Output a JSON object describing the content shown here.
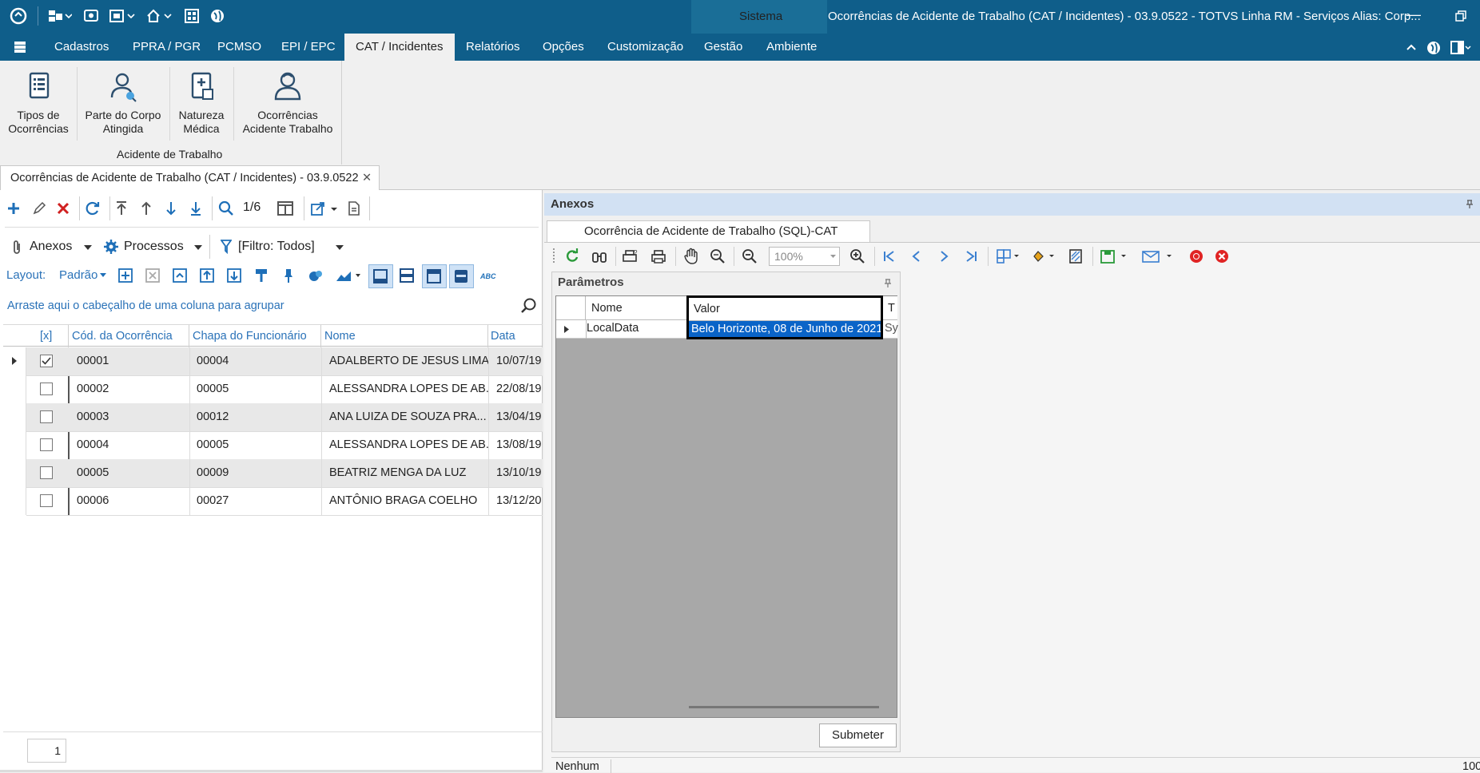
{
  "titlebar": {
    "sistema": "Sistema",
    "title": "Ocorrências de Acidente de Trabalho (CAT / Incidentes) - 03.9.0522 - TOTVS Linha RM - Serviços  Alias: Corp..."
  },
  "menu": [
    "Cadastros",
    "PPRA / PGR",
    "PCMSO",
    "EPI / EPC",
    "CAT / Incidentes",
    "Relatórios",
    "Opções",
    "Customização",
    "Gestão",
    "Ambiente"
  ],
  "ribbon": {
    "buttons": [
      {
        "label1": "Tipos de",
        "label2": "Ocorrências",
        "icon": "document-list-icon"
      },
      {
        "label1": "Parte do Corpo",
        "label2": "Atingida",
        "icon": "person-search-icon"
      },
      {
        "label1": "Natureza",
        "label2": "Médica",
        "icon": "medical-book-icon"
      },
      {
        "label1": "Ocorrências",
        "label2": "Acidente Trabalho",
        "icon": "person-icon"
      }
    ],
    "group": "Acidente de Trabalho"
  },
  "doc_tab": "Ocorrências de Acidente de Trabalho (CAT / Incidentes) - 03.9.0522",
  "left": {
    "record_counter": "1/6",
    "anexos": "Anexos",
    "processos": "Processos",
    "filtro": "[Filtro: Todos]",
    "layout_label": "Layout:",
    "layout_value": "Padrão",
    "group_hint": "Arraste aqui o cabeçalho de uma coluna para agrupar",
    "columns": [
      "[x]",
      "Cód. da Ocorrência",
      "Chapa do Funcionário",
      "Nome",
      "Data"
    ],
    "rows": [
      {
        "checked": true,
        "cod": "00001",
        "chapa": "00004",
        "nome": "ADALBERTO DE JESUS LIMA",
        "data": "10/07/19"
      },
      {
        "checked": false,
        "cod": "00002",
        "chapa": "00005",
        "nome": "ALESSANDRA LOPES DE AB...",
        "data": "22/08/19"
      },
      {
        "checked": false,
        "cod": "00003",
        "chapa": "00012",
        "nome": "ANA LUIZA  DE SOUZA PRA...",
        "data": "13/04/19"
      },
      {
        "checked": false,
        "cod": "00004",
        "chapa": "00005",
        "nome": "ALESSANDRA LOPES DE AB...",
        "data": "13/08/19"
      },
      {
        "checked": false,
        "cod": "00005",
        "chapa": "00009",
        "nome": "BEATRIZ MENGA DA LUZ",
        "data": "13/10/19"
      },
      {
        "checked": false,
        "cod": "00006",
        "chapa": "00027",
        "nome": "ANTÔNIO BRAGA COELHO",
        "data": "13/12/20"
      }
    ],
    "page": "1"
  },
  "right": {
    "header": "Anexos",
    "report_tab": "Ocorrência de Acidente de Trabalho (SQL)-CAT",
    "zoom": "100%",
    "params_title": "Parâmetros",
    "param_columns": [
      "Nome",
      "Valor",
      "T"
    ],
    "param_row": {
      "nome": "LocalData",
      "valor": "Belo Horizonte, 08 de Junho de 2021.",
      "tipo": "Sy"
    },
    "submit": "Submeter",
    "status_left": "Nenhum",
    "status_right": "100"
  }
}
